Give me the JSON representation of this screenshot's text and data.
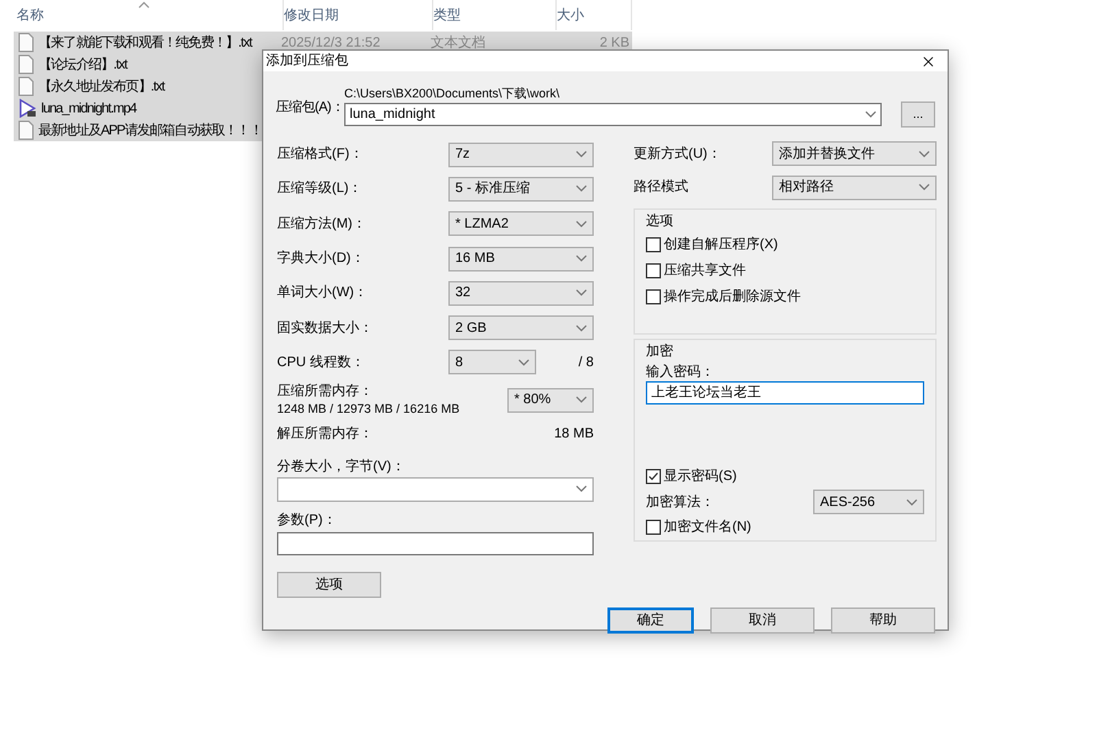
{
  "explorer": {
    "columns": [
      "名称",
      "修改日期",
      "类型",
      "大小"
    ],
    "rows": [
      {
        "name": "【来了就能下载和观看！纯免费！】.txt",
        "kind": "text",
        "selected": true,
        "date": "2025/12/3 21:52",
        "type": "文本文档",
        "size": "2 KB"
      },
      {
        "name": "【论坛介绍】.txt",
        "kind": "text",
        "selected": true
      },
      {
        "name": "【永久地址发布页】.txt",
        "kind": "text",
        "selected": true
      },
      {
        "name": "luna_midnight.mp4",
        "kind": "video",
        "selected": true
      },
      {
        "name": "最新地址及APP请发邮箱自动获取！！！",
        "kind": "text",
        "selected": true
      }
    ]
  },
  "dialog": {
    "title": "添加到压缩包",
    "archive": {
      "label": "压缩包(A)：",
      "path": "C:\\Users\\BX200\\Documents\\下载\\work\\",
      "value": "luna_midnight",
      "browse": "..."
    },
    "left_fields": [
      {
        "label": "压缩格式(F)：",
        "value": "7z"
      },
      {
        "label": "压缩等级(L)：",
        "value": "5 - 标准压缩"
      },
      {
        "label": "压缩方法(M)：",
        "value": "* LZMA2"
      },
      {
        "label": "字典大小(D)：",
        "value": "16 MB"
      },
      {
        "label": "单词大小(W)：",
        "value": "32"
      },
      {
        "label": "固实数据大小：",
        "value": "2 GB"
      }
    ],
    "cpu": {
      "label": "CPU 线程数：",
      "value": "8",
      "max": "/ 8"
    },
    "memory": {
      "label": "压缩所需内存：",
      "detail": "1248 MB / 12973 MB / 16216 MB",
      "value": "* 80%"
    },
    "decompress": {
      "label": "解压所需内存：",
      "value": "18 MB"
    },
    "split": {
      "label": "分卷大小，字节(V)："
    },
    "params": {
      "label": "参数(P)："
    },
    "options_button": "选项",
    "right_fields": [
      {
        "label": "更新方式(U)：",
        "value": "添加并替换文件"
      },
      {
        "label": "路径模式",
        "value": "相对路径"
      }
    ],
    "options": {
      "title": "选项",
      "checkboxes": [
        {
          "label": "创建自解压程序(X)",
          "checked": false
        },
        {
          "label": "压缩共享文件",
          "checked": false
        },
        {
          "label": "操作完成后删除源文件",
          "checked": false
        }
      ]
    },
    "encryption": {
      "title": "加密",
      "password_label": "输入密码：",
      "password": "上老王论坛当老王",
      "focused": true,
      "show_password": {
        "label": "显示密码(S)",
        "checked": true
      },
      "algorithm": {
        "label": "加密算法：",
        "value": "AES-256"
      },
      "encrypt_names": {
        "label": "加密文件名(N)",
        "checked": false
      }
    },
    "buttons": [
      {
        "label": "确定",
        "default": true
      },
      {
        "label": "取消",
        "default": false
      },
      {
        "label": "帮助",
        "default": false
      }
    ]
  }
}
